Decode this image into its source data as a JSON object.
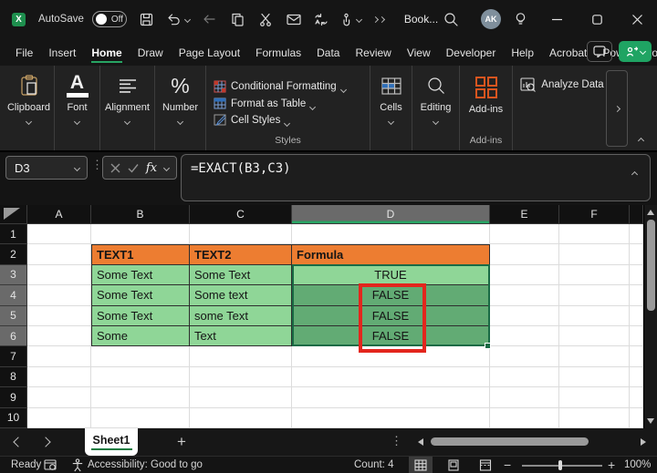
{
  "window": {
    "title": "Book...",
    "autosave_label": "AutoSave",
    "autosave_state": "Off",
    "avatar_initials": "AK"
  },
  "menu": {
    "tabs": [
      "File",
      "Insert",
      "Home",
      "Draw",
      "Page Layout",
      "Formulas",
      "Data",
      "Review",
      "View",
      "Developer",
      "Help",
      "Acrobat",
      "Power Pivot"
    ],
    "active_tab": "Home"
  },
  "ribbon": {
    "clipboard": "Clipboard",
    "font": "Font",
    "alignment": "Alignment",
    "number": "Number",
    "conditional_formatting": "Conditional Formatting",
    "format_as_table": "Format as Table",
    "cell_styles": "Cell Styles",
    "styles_group": "Styles",
    "cells": "Cells",
    "editing": "Editing",
    "addins": "Add-ins",
    "addins_group": "Add-ins",
    "analyze_data": "Analyze Data",
    "icons": {
      "font_letter": "A",
      "number_symbol": "%"
    }
  },
  "formula_bar": {
    "name_box": "D3",
    "formula": "=EXACT(B3,C3)",
    "fx_label": "fx"
  },
  "sheet": {
    "columns": [
      "A",
      "B",
      "C",
      "D",
      "E",
      "F"
    ],
    "rows": [
      "1",
      "2",
      "3",
      "4",
      "5",
      "6",
      "7",
      "8",
      "9",
      "10"
    ],
    "cells": {
      "B2": "TEXT1",
      "C2": "TEXT2",
      "D2": "Formula",
      "B3": "Some Text",
      "C3": "Some Text",
      "D3": "TRUE",
      "B4": "Some Text",
      "C4": "Some text",
      "D4": "FALSE",
      "B5": "Some Text",
      "C5": "some Text",
      "D5": "FALSE",
      "B6": "Some",
      "C6": "Text",
      "D6": "FALSE"
    },
    "active_cell": "D3",
    "selected_range": "D3:D6",
    "selected_column": "D",
    "selected_rows": [
      "3",
      "4",
      "5",
      "6"
    ]
  },
  "sheet_tabs": {
    "tabs": [
      "Sheet1"
    ],
    "active": "Sheet1"
  },
  "status_bar": {
    "mode": "Ready",
    "accessibility": "Accessibility: Good to go",
    "count": "Count: 4",
    "zoom_level": "100%"
  },
  "colors": {
    "excel_green": "#107C41",
    "share_green": "#1FA463",
    "header_orange": "#ED7D31",
    "cell_light_green": "#8FD697",
    "cell_selected_green": "#62AB74",
    "annotation_red": "#E3261D",
    "addins_orange": "#D8551F"
  }
}
